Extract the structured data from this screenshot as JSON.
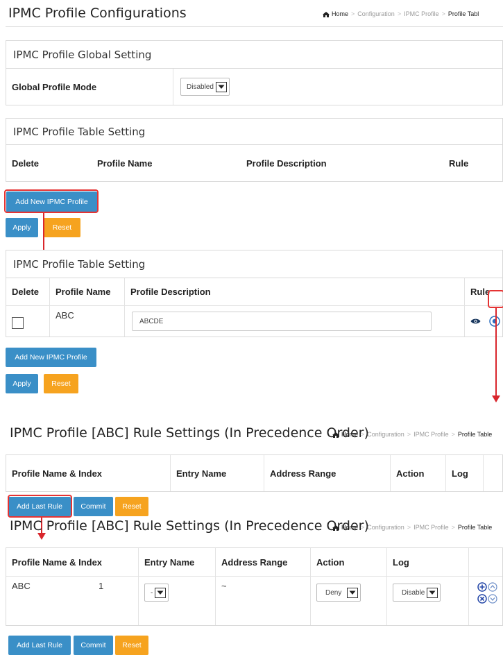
{
  "top": {
    "title": "IPMC Profile Configurations",
    "breadcrumb": [
      "Home",
      "Configuration",
      "IPMC Profile",
      "Profile Tabl"
    ]
  },
  "global": {
    "heading": "IPMC Profile Global Setting",
    "mode_label": "Global Profile Mode",
    "mode_value": "Disabled"
  },
  "table1": {
    "heading": "IPMC Profile Table Setting",
    "cols": [
      "Delete",
      "Profile Name",
      "Profile Description",
      "Rule"
    ]
  },
  "table2": {
    "heading": "IPMC Profile Table Setting",
    "cols": [
      "Delete",
      "Profile Name",
      "Profile Description",
      "Rule"
    ],
    "row": {
      "name": "ABC",
      "description": "ABCDE"
    }
  },
  "buttons": {
    "add_profile": "Add New IPMC Profile",
    "apply": "Apply",
    "reset": "Reset",
    "add_last_rule": "Add Last Rule",
    "commit": "Commit"
  },
  "rules1": {
    "title": "IPMC Profile [ABC] Rule Settings (In Precedence Order)",
    "breadcrumb": [
      "Home",
      "Configuration",
      "IPMC Profile",
      "Profile Table"
    ],
    "cols": [
      "Profile Name & Index",
      "Entry Name",
      "Address Range",
      "Action",
      "Log"
    ]
  },
  "rules2": {
    "title": "IPMC Profile [ABC] Rule Settings (In Precedence Order)",
    "breadcrumb": [
      "Home",
      "Configuration",
      "IPMC Profile",
      "Profile Table"
    ],
    "cols": [
      "Profile Name & Index",
      "Entry Name",
      "Address Range",
      "Action",
      "Log"
    ],
    "row": {
      "name": "ABC",
      "index": "1",
      "entry": "-",
      "range": "~",
      "action": "Deny",
      "log": "Disable"
    }
  },
  "colors": {
    "blue": "#3a8fc7",
    "orange": "#f6a31f",
    "highlight": "#e53333"
  }
}
